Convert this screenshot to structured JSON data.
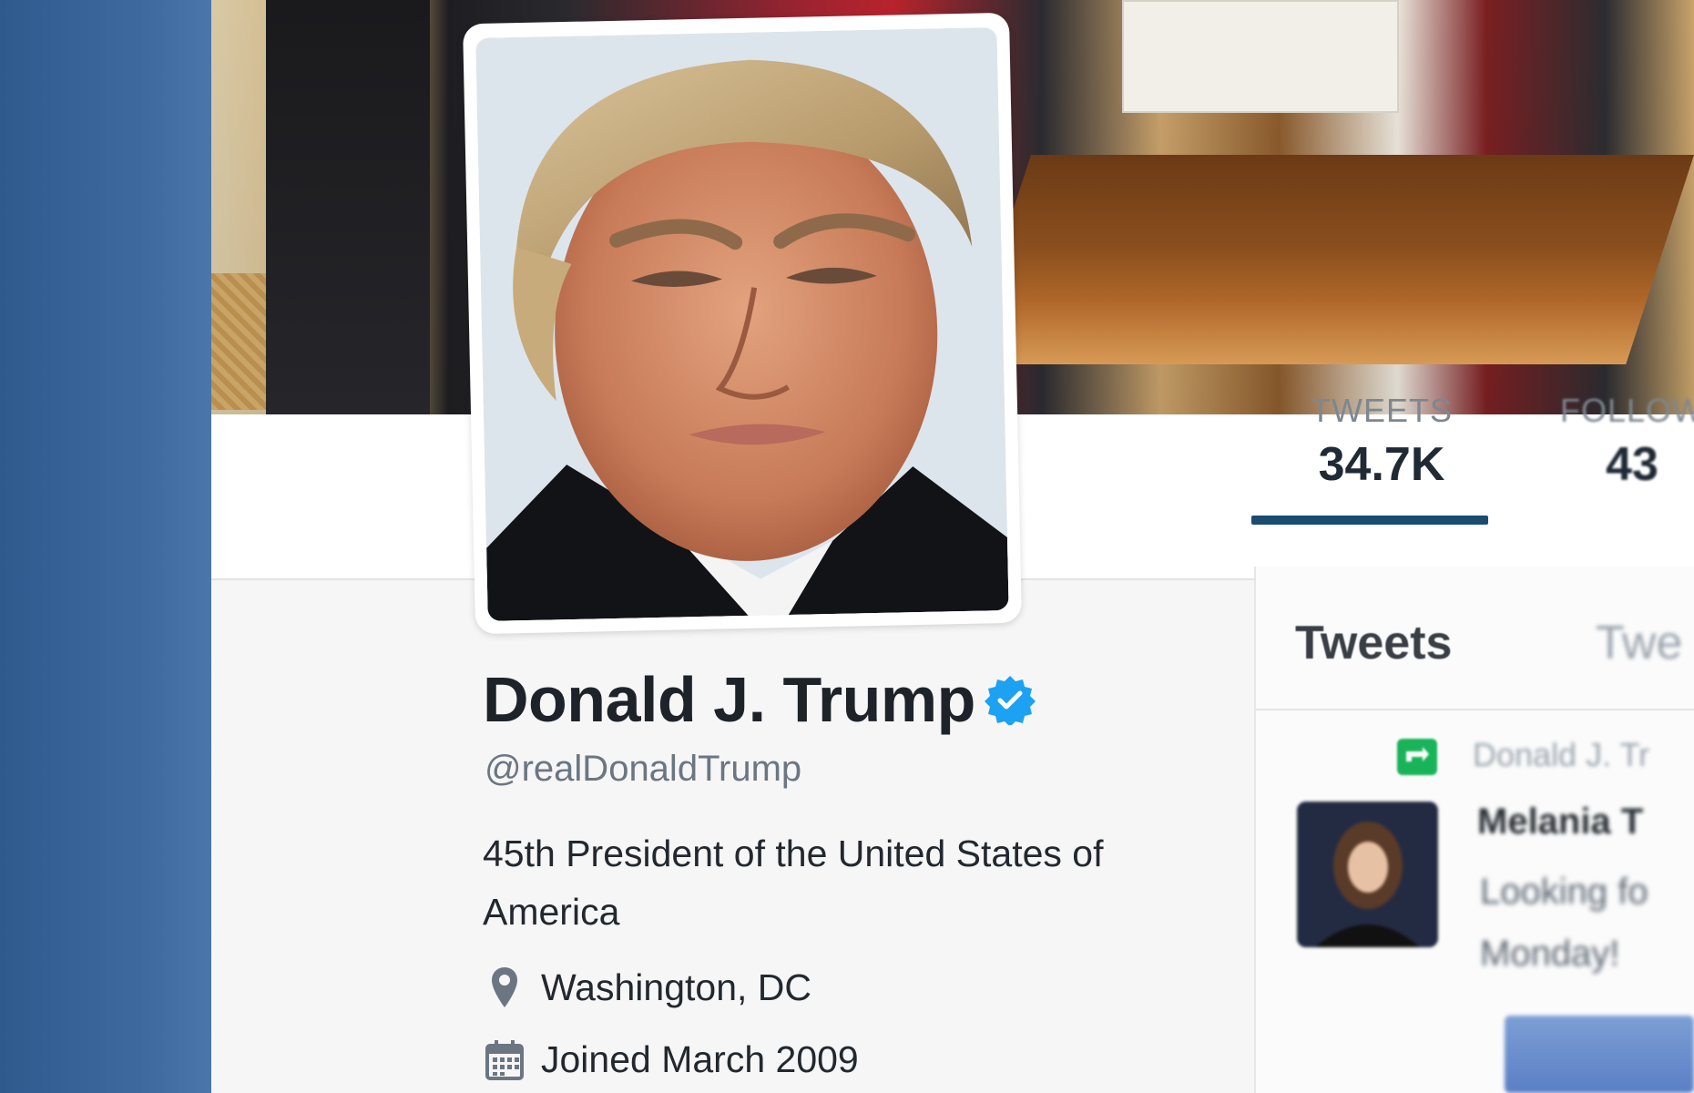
{
  "profile": {
    "name": "Donald J. Trump",
    "handle": "@realDonaldTrump",
    "bio": "45th President of the United States of America",
    "location": "Washington, DC",
    "joined": "Joined March 2009",
    "verified_icon": "verified-badge-icon"
  },
  "stats": {
    "tweets_label": "TWEETS",
    "tweets_value": "34.7K",
    "following_label": "FOLLOW",
    "following_value": "43"
  },
  "tabs": {
    "active": "Tweets",
    "second": "Twe"
  },
  "timeline": {
    "retweet_author": "Donald J. Tr",
    "tweet_name": "Melania T",
    "tweet_text_line1": "Looking fo",
    "tweet_text_line2": "Monday!"
  },
  "colors": {
    "bezel": "#3b6496",
    "verified": "#1da1f2",
    "tab_underline": "#1b4b70",
    "retweet_green": "#19b45a"
  }
}
